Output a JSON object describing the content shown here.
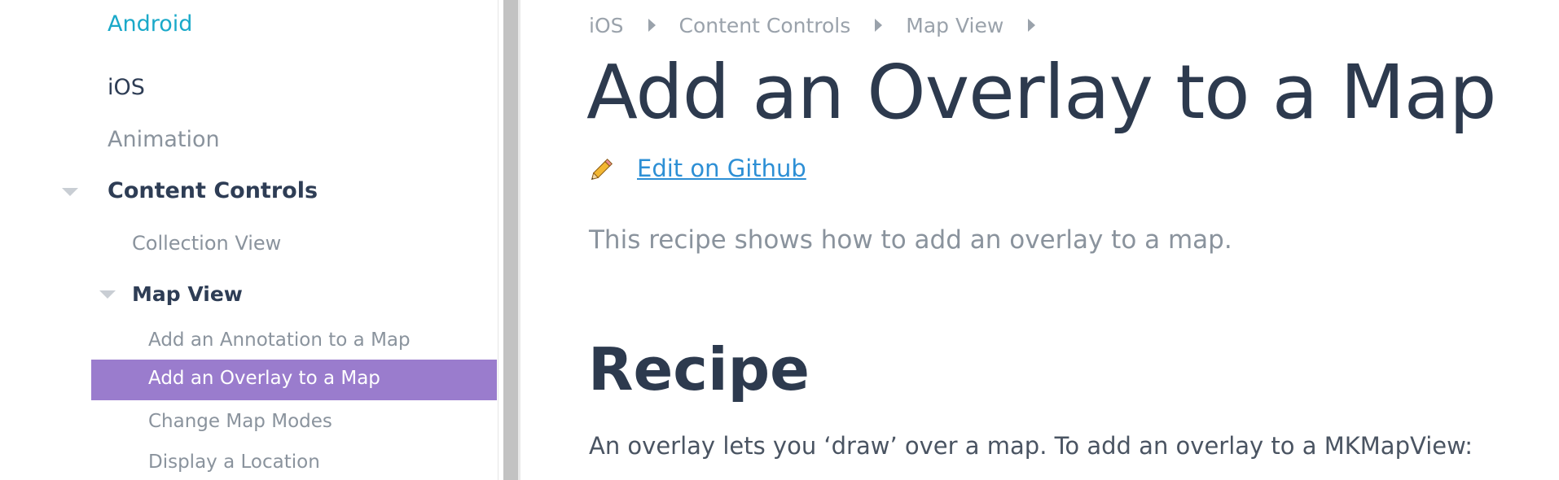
{
  "sidebar": {
    "android": "Android",
    "ios": "iOS",
    "animation": "Animation",
    "content_controls": "Content Controls",
    "collection_view": "Collection View",
    "map_view": "Map View",
    "map_items": [
      "Add an Annotation to a Map",
      "Add an Overlay to a Map",
      "Change Map Modes",
      "Display a Location"
    ],
    "active_index": 1
  },
  "breadcrumb": [
    "iOS",
    "Content Controls",
    "Map View"
  ],
  "page": {
    "title": "Add an Overlay to a Map",
    "edit_link": "Edit on Github",
    "intro": "This recipe shows how to add an overlay to a map.",
    "section_title": "Recipe",
    "paragraph": "An overlay lets you ‘draw’ over a map. To add an overlay to a MKMapView:"
  },
  "colors": {
    "accent_purple": "#9a7ccd",
    "link_blue": "#2d8fd5",
    "android_teal": "#1aa9c9",
    "heading_navy": "#2d3a4e"
  }
}
